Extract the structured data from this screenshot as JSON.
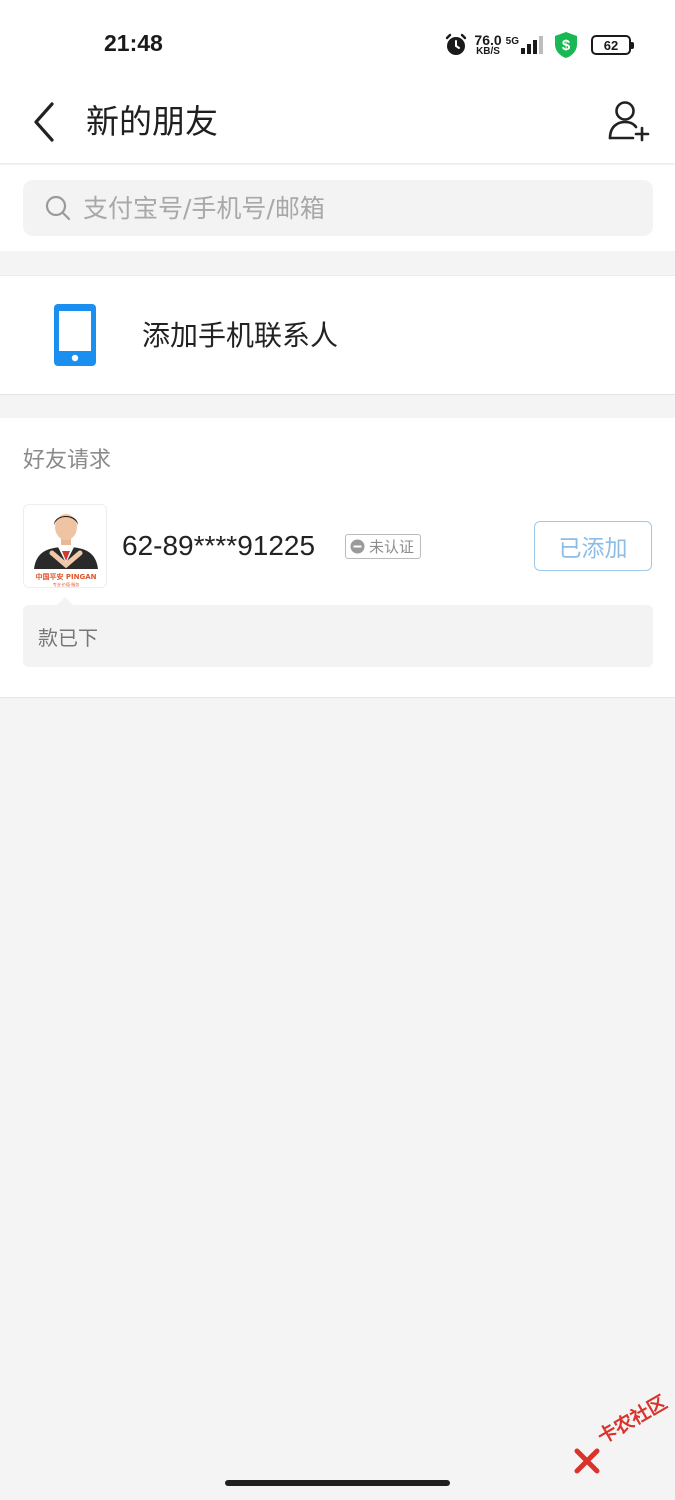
{
  "status_bar": {
    "time": "21:48",
    "net_speed": "76.0",
    "net_speed_unit": "KB/S",
    "network_type": "5G",
    "battery": "62"
  },
  "header": {
    "title": "新的朋友"
  },
  "search": {
    "placeholder": "支付宝号/手机号/邮箱"
  },
  "phone_contacts": {
    "label": "添加手机联系人"
  },
  "friend_requests": {
    "header": "好友请求",
    "items": [
      {
        "name": "62-89****91225",
        "badge": "未认证",
        "action_label": "已添加",
        "message": "款已下",
        "avatar_caption": "中国平安 PINGAN",
        "avatar_caption_sub": "专业·价值·服务"
      }
    ]
  },
  "watermark": {
    "text": "卡农社区"
  },
  "colors": {
    "accent_blue": "#1b8ff0",
    "added_border": "#9fc9ea",
    "shield_green": "#19b853",
    "watermark_red": "#d9332b"
  }
}
